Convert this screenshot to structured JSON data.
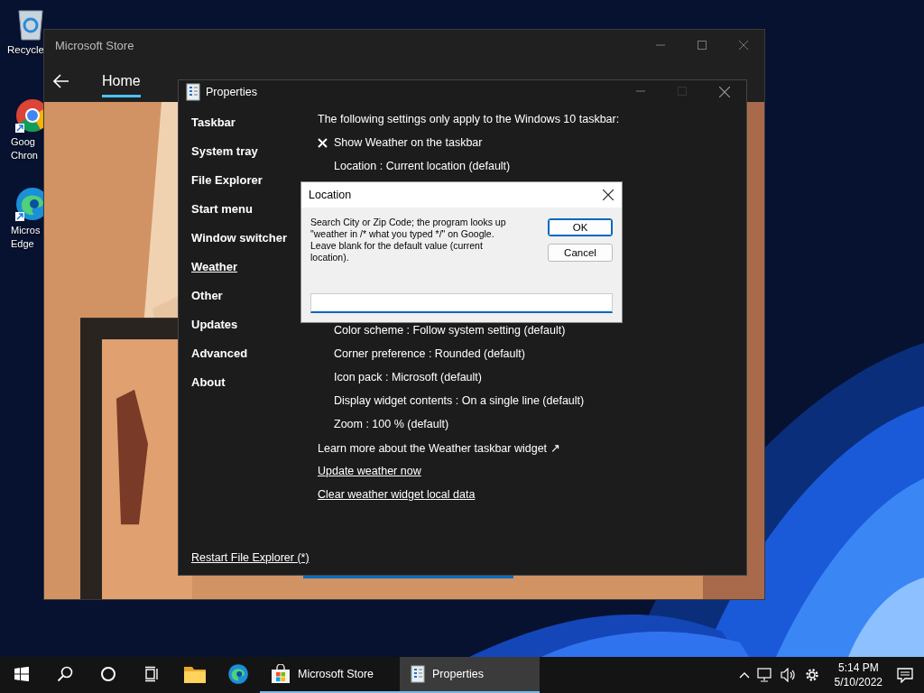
{
  "desktop_icons": [
    {
      "kind": "recycle",
      "label": "Recycle"
    },
    {
      "kind": "chrome",
      "label": "Goog Chron"
    },
    {
      "kind": "edge",
      "label": "Micros Edge"
    }
  ],
  "store_window": {
    "title": "Microsoft Store",
    "tabs": [
      {
        "label": "Home",
        "selected": true
      }
    ]
  },
  "properties_window": {
    "title": "Properties",
    "sidebar": {
      "items": [
        {
          "label": "Taskbar",
          "selected": false
        },
        {
          "label": "System tray",
          "selected": false
        },
        {
          "label": "File Explorer",
          "selected": false
        },
        {
          "label": "Start menu",
          "selected": false
        },
        {
          "label": "Window switcher",
          "selected": false
        },
        {
          "label": "Weather",
          "selected": true
        },
        {
          "label": "Other",
          "selected": false
        },
        {
          "label": "Updates",
          "selected": false
        },
        {
          "label": "Advanced",
          "selected": false
        },
        {
          "label": "About",
          "selected": false
        }
      ],
      "footer_link": "Restart File Explorer (*)"
    },
    "settings_top": [
      {
        "kind": "header",
        "label": "The following settings only apply to the Windows 10 taskbar:"
      },
      {
        "kind": "check",
        "label": "Show Weather on the taskbar",
        "checked": true
      },
      {
        "kind": "option",
        "label": "Location : Current location (default)"
      }
    ],
    "settings_bottom": [
      {
        "kind": "option",
        "label": "Color scheme : Follow system setting (default)"
      },
      {
        "kind": "option",
        "label": "Corner preference : Rounded (default)"
      },
      {
        "kind": "option",
        "label": "Icon pack : Microsoft (default)"
      },
      {
        "kind": "option",
        "label": "Display widget contents : On a single line (default)"
      },
      {
        "kind": "option",
        "label": "Zoom : 100 % (default)"
      },
      {
        "kind": "link",
        "label": "Learn more about the Weather taskbar widget ↗"
      },
      {
        "kind": "action",
        "label": "Update weather now"
      },
      {
        "kind": "action",
        "label": "Clear weather widget local data"
      }
    ]
  },
  "location_dialog": {
    "title": "Location",
    "message": "Search City or Zip Code; the program looks up \"weather in /* what you typed */\" on Google. Leave blank for the default value (current location).",
    "buttons": [
      {
        "label": "OK",
        "selected": true
      },
      {
        "label": "Cancel",
        "selected": false
      }
    ]
  },
  "taskbar": {
    "items": [
      {
        "kind": "start",
        "selected": false
      },
      {
        "kind": "search",
        "selected": false
      },
      {
        "kind": "cortana",
        "selected": false
      },
      {
        "kind": "taskview",
        "selected": false
      },
      {
        "kind": "explorer",
        "selected": false
      },
      {
        "kind": "edge",
        "selected": false
      },
      {
        "kind": "store",
        "label": "Microsoft Store",
        "selected": false
      },
      {
        "kind": "properties",
        "label": "Properties",
        "selected": true
      }
    ],
    "time": "5:14 PM",
    "date": "5/10/2022"
  }
}
